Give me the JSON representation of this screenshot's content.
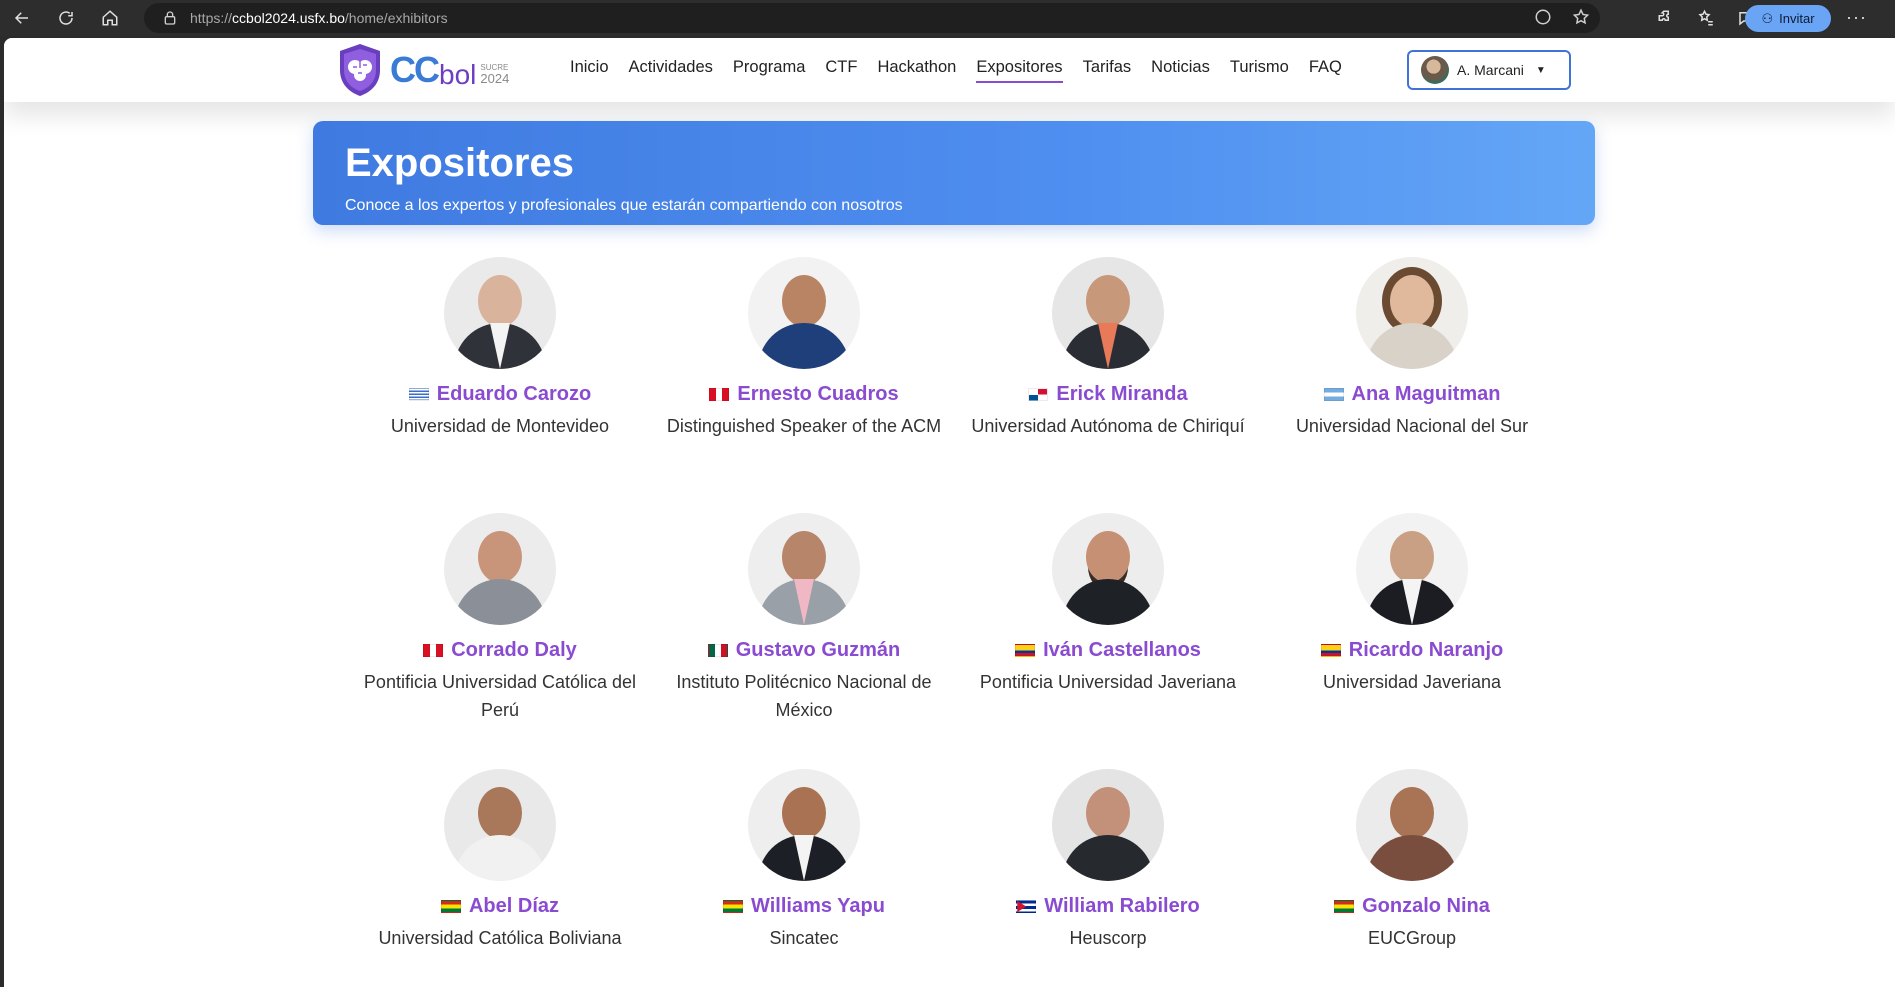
{
  "browser": {
    "url_scheme": "https://",
    "url_host": "ccbol2024.usfx.bo",
    "url_path": "/home/exhibitors",
    "invite_label": "Invitar"
  },
  "site": {
    "logo": {
      "cc": "CC",
      "bol": "bol",
      "city": "SUCRE",
      "year": "2024"
    },
    "nav": [
      {
        "label": "Inicio",
        "active": false
      },
      {
        "label": "Actividades",
        "active": false
      },
      {
        "label": "Programa",
        "active": false
      },
      {
        "label": "CTF",
        "active": false
      },
      {
        "label": "Hackathon",
        "active": false
      },
      {
        "label": "Expositores",
        "active": true
      },
      {
        "label": "Tarifas",
        "active": false
      },
      {
        "label": "Noticias",
        "active": false
      },
      {
        "label": "Turismo",
        "active": false
      },
      {
        "label": "FAQ",
        "active": false
      }
    ],
    "user_name": "A. Marcani"
  },
  "hero": {
    "title": "Expositores",
    "subtitle": "Conoce a los expertos y profesionales que estarán compartiendo con nosotros"
  },
  "colors": {
    "accent": "#8a4bd1",
    "hero_start": "#3f7ae0",
    "hero_end": "#64a6f6"
  },
  "speakers": [
    {
      "name": "Eduardo Carozo",
      "affiliation": "Universidad de Montevideo",
      "flag": "uy"
    },
    {
      "name": "Ernesto Cuadros",
      "affiliation": "Distinguished Speaker of the ACM",
      "flag": "pe"
    },
    {
      "name": "Erick Miranda",
      "affiliation": "Universidad Autónoma de Chiriquí",
      "flag": "pa"
    },
    {
      "name": "Ana Maguitman",
      "affiliation": "Universidad Nacional del Sur",
      "flag": "ar"
    },
    {
      "name": "Corrado Daly",
      "affiliation": "Pontificia Universidad Católica del Perú",
      "flag": "pe"
    },
    {
      "name": "Gustavo Guzmán",
      "affiliation": "Instituto Politécnico Nacional de México",
      "flag": "mx"
    },
    {
      "name": "Iván Castellanos",
      "affiliation": "Pontificia Universidad Javeriana",
      "flag": "co"
    },
    {
      "name": "Ricardo Naranjo",
      "affiliation": "Universidad Javeriana",
      "flag": "co"
    },
    {
      "name": "Abel Díaz",
      "affiliation": "Universidad Católica Boliviana",
      "flag": "bo"
    },
    {
      "name": "Williams Yapu",
      "affiliation": "Sincatec",
      "flag": "bo"
    },
    {
      "name": "William Rabilero",
      "affiliation": "Heuscorp",
      "flag": "cu"
    },
    {
      "name": "Gonzalo Nina",
      "affiliation": "EUCGroup",
      "flag": "bo"
    }
  ]
}
